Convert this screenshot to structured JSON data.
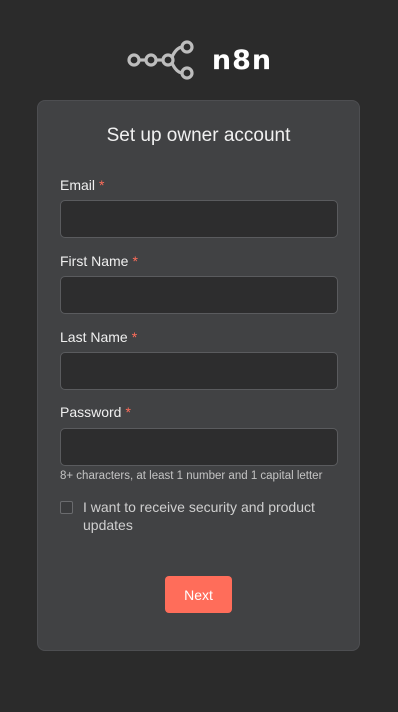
{
  "brand": {
    "name": "n8n",
    "logo_icon": "n8n-logo-icon",
    "accent": "#ff6d5a"
  },
  "form": {
    "title": "Set up owner account",
    "required_marker": "*",
    "fields": [
      {
        "label": "Email",
        "value": "",
        "placeholder": ""
      },
      {
        "label": "First Name",
        "value": "",
        "placeholder": ""
      },
      {
        "label": "Last Name",
        "value": "",
        "placeholder": ""
      },
      {
        "label": "Password",
        "value": "",
        "placeholder": ""
      }
    ],
    "password_hint": "8+ characters, at least 1 number and 1 capital letter",
    "updates_checkbox": {
      "label": "I want to receive security and product updates",
      "checked": false
    },
    "submit_label": "Next"
  }
}
